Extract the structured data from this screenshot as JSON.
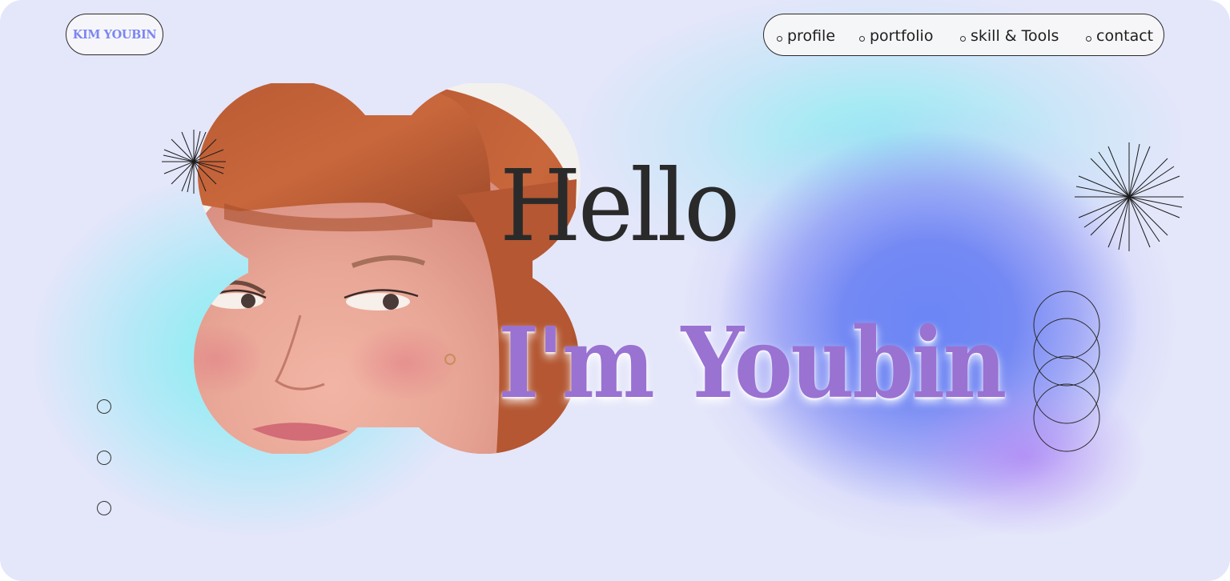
{
  "brand": {
    "logo_text": "KIM YOUBIN"
  },
  "nav": {
    "items": [
      {
        "label": "profile"
      },
      {
        "label": "portfolio"
      },
      {
        "label": "skill & Tools"
      },
      {
        "label": "contact"
      }
    ]
  },
  "hero": {
    "greeting": "Hello",
    "intro": "I'm Youbin"
  },
  "pagination": {
    "count": 3
  },
  "colors": {
    "background": "#e4e6fa",
    "accent_blue": "#6b86f5",
    "accent_cyan": "#82eef0",
    "accent_purple": "#9a72d2",
    "logo_text": "#7b86f2",
    "ink": "#2a2a2a"
  },
  "icons": [
    "starburst-icon",
    "starburst-icon",
    "stacked-rings-icon",
    "slide-dot-icon"
  ]
}
